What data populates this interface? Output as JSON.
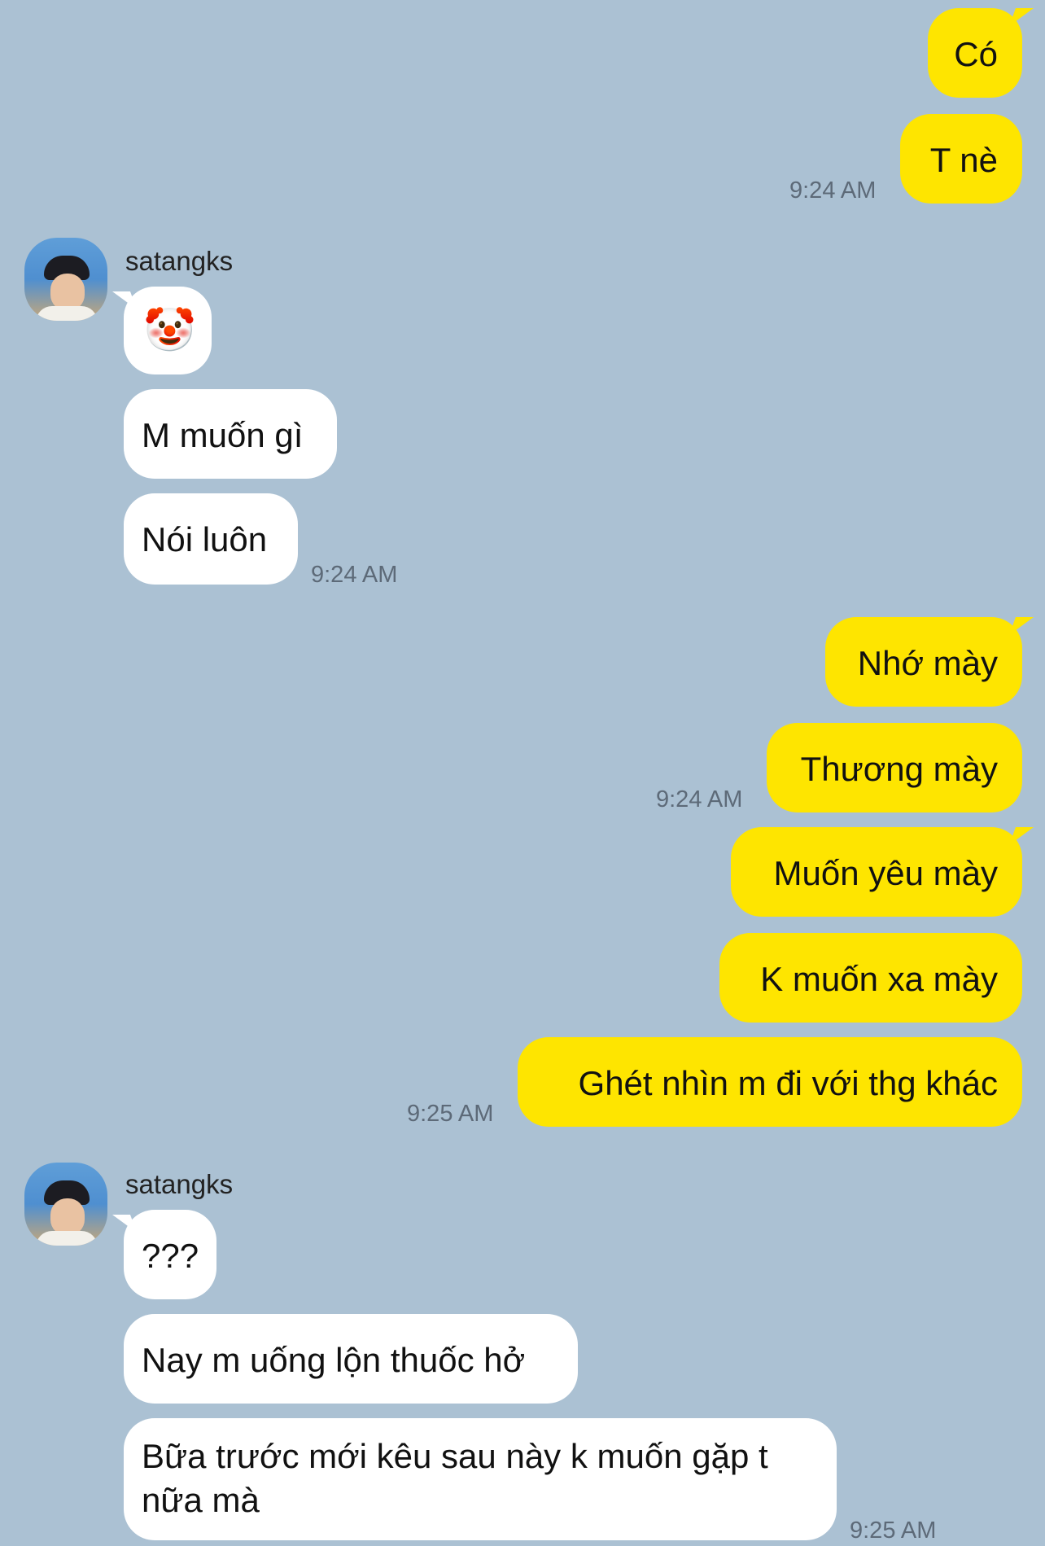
{
  "chat": {
    "group1": {
      "m1": "Có",
      "m2": "T nè",
      "time": "9:24 AM"
    },
    "group2": {
      "sender": "satangks",
      "m1": "🤡",
      "m2": "M muốn gì",
      "m3": "Nói luôn",
      "time": "9:24 AM"
    },
    "group3": {
      "m1": "Nhớ mày",
      "m2": "Thương mày",
      "time1": "9:24 AM",
      "m3": "Muốn yêu mày",
      "m4": "K muốn xa mày",
      "m5": "Ghét nhìn m đi với thg khác",
      "time2": "9:25 AM"
    },
    "group4": {
      "sender": "satangks",
      "m1": "???",
      "m2": "Nay m uống lộn thuốc hở",
      "m3": "Bữa trước mới kêu sau này k muốn gặp t nữa mà",
      "time": "9:25 AM"
    }
  },
  "colors": {
    "background": "#abc1d3",
    "outgoing": "#fee500",
    "incoming": "#ffffff"
  }
}
